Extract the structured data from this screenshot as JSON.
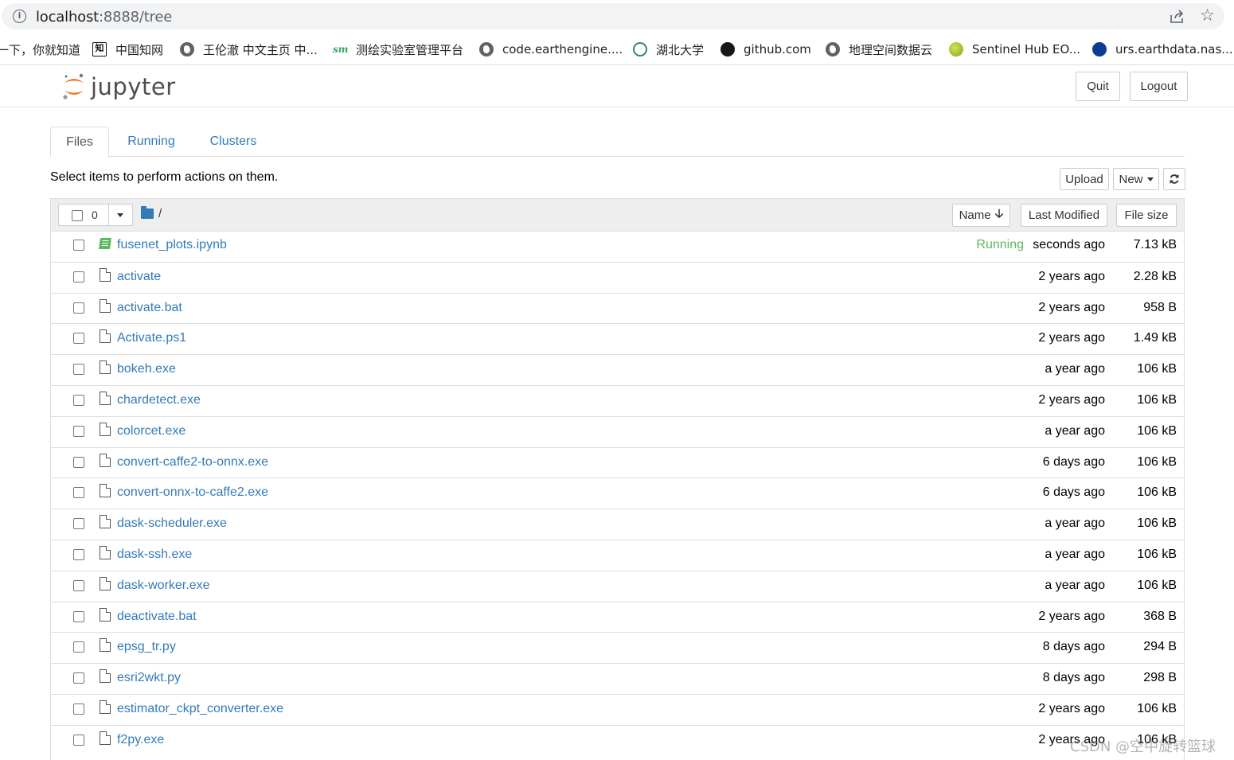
{
  "browser": {
    "url_host": "localhost",
    "url_path": ":8888/tree",
    "bookmarks": [
      {
        "label": "一下，你就知道",
        "icon": "none"
      },
      {
        "label": "中国知网",
        "icon": "zhi-icon"
      },
      {
        "label": "王伦澈 中文主页 中...",
        "icon": "globe-icon"
      },
      {
        "label": "测绘实验室管理平台",
        "icon": "sm-icon"
      },
      {
        "label": "code.earthengine....",
        "icon": "globe-icon"
      },
      {
        "label": "湖北大学",
        "icon": "hubu-icon"
      },
      {
        "label": "github.com",
        "icon": "github-icon"
      },
      {
        "label": "地理空间数据云",
        "icon": "globe-icon"
      },
      {
        "label": "Sentinel Hub EO...",
        "icon": "sentinel-icon"
      },
      {
        "label": "urs.earthdata.nas...",
        "icon": "nasa-icon"
      }
    ]
  },
  "header": {
    "logo_text": "jupyter",
    "quit_label": "Quit",
    "logout_label": "Logout"
  },
  "tabs": [
    {
      "label": "Files",
      "active": true
    },
    {
      "label": "Running",
      "active": false
    },
    {
      "label": "Clusters",
      "active": false
    }
  ],
  "toolbar": {
    "hint": "Select items to perform actions on them.",
    "upload_label": "Upload",
    "new_label": "New",
    "refresh_icon": "refresh-icon"
  },
  "list_header": {
    "selected_count": "0",
    "breadcrumb": "/",
    "name_label": "Name",
    "last_modified_label": "Last Modified",
    "file_size_label": "File size"
  },
  "files": [
    {
      "name": "fusenet_plots.ipynb",
      "type": "notebook",
      "status": "Running",
      "modified": "seconds ago",
      "size": "7.13 kB"
    },
    {
      "name": "activate",
      "type": "file",
      "status": "",
      "modified": "2 years ago",
      "size": "2.28 kB"
    },
    {
      "name": "activate.bat",
      "type": "file",
      "status": "",
      "modified": "2 years ago",
      "size": "958 B"
    },
    {
      "name": "Activate.ps1",
      "type": "file",
      "status": "",
      "modified": "2 years ago",
      "size": "1.49 kB"
    },
    {
      "name": "bokeh.exe",
      "type": "file",
      "status": "",
      "modified": "a year ago",
      "size": "106 kB"
    },
    {
      "name": "chardetect.exe",
      "type": "file",
      "status": "",
      "modified": "2 years ago",
      "size": "106 kB"
    },
    {
      "name": "colorcet.exe",
      "type": "file",
      "status": "",
      "modified": "a year ago",
      "size": "106 kB"
    },
    {
      "name": "convert-caffe2-to-onnx.exe",
      "type": "file",
      "status": "",
      "modified": "6 days ago",
      "size": "106 kB"
    },
    {
      "name": "convert-onnx-to-caffe2.exe",
      "type": "file",
      "status": "",
      "modified": "6 days ago",
      "size": "106 kB"
    },
    {
      "name": "dask-scheduler.exe",
      "type": "file",
      "status": "",
      "modified": "a year ago",
      "size": "106 kB"
    },
    {
      "name": "dask-ssh.exe",
      "type": "file",
      "status": "",
      "modified": "a year ago",
      "size": "106 kB"
    },
    {
      "name": "dask-worker.exe",
      "type": "file",
      "status": "",
      "modified": "a year ago",
      "size": "106 kB"
    },
    {
      "name": "deactivate.bat",
      "type": "file",
      "status": "",
      "modified": "2 years ago",
      "size": "368 B"
    },
    {
      "name": "epsg_tr.py",
      "type": "file",
      "status": "",
      "modified": "8 days ago",
      "size": "294 B"
    },
    {
      "name": "esri2wkt.py",
      "type": "file",
      "status": "",
      "modified": "8 days ago",
      "size": "298 B"
    },
    {
      "name": "estimator_ckpt_converter.exe",
      "type": "file",
      "status": "",
      "modified": "2 years ago",
      "size": "106 kB"
    },
    {
      "name": "f2py.exe",
      "type": "file",
      "status": "",
      "modified": "2 years ago",
      "size": "106 kB"
    }
  ],
  "watermark": "CSDN @空中旋转篮球"
}
